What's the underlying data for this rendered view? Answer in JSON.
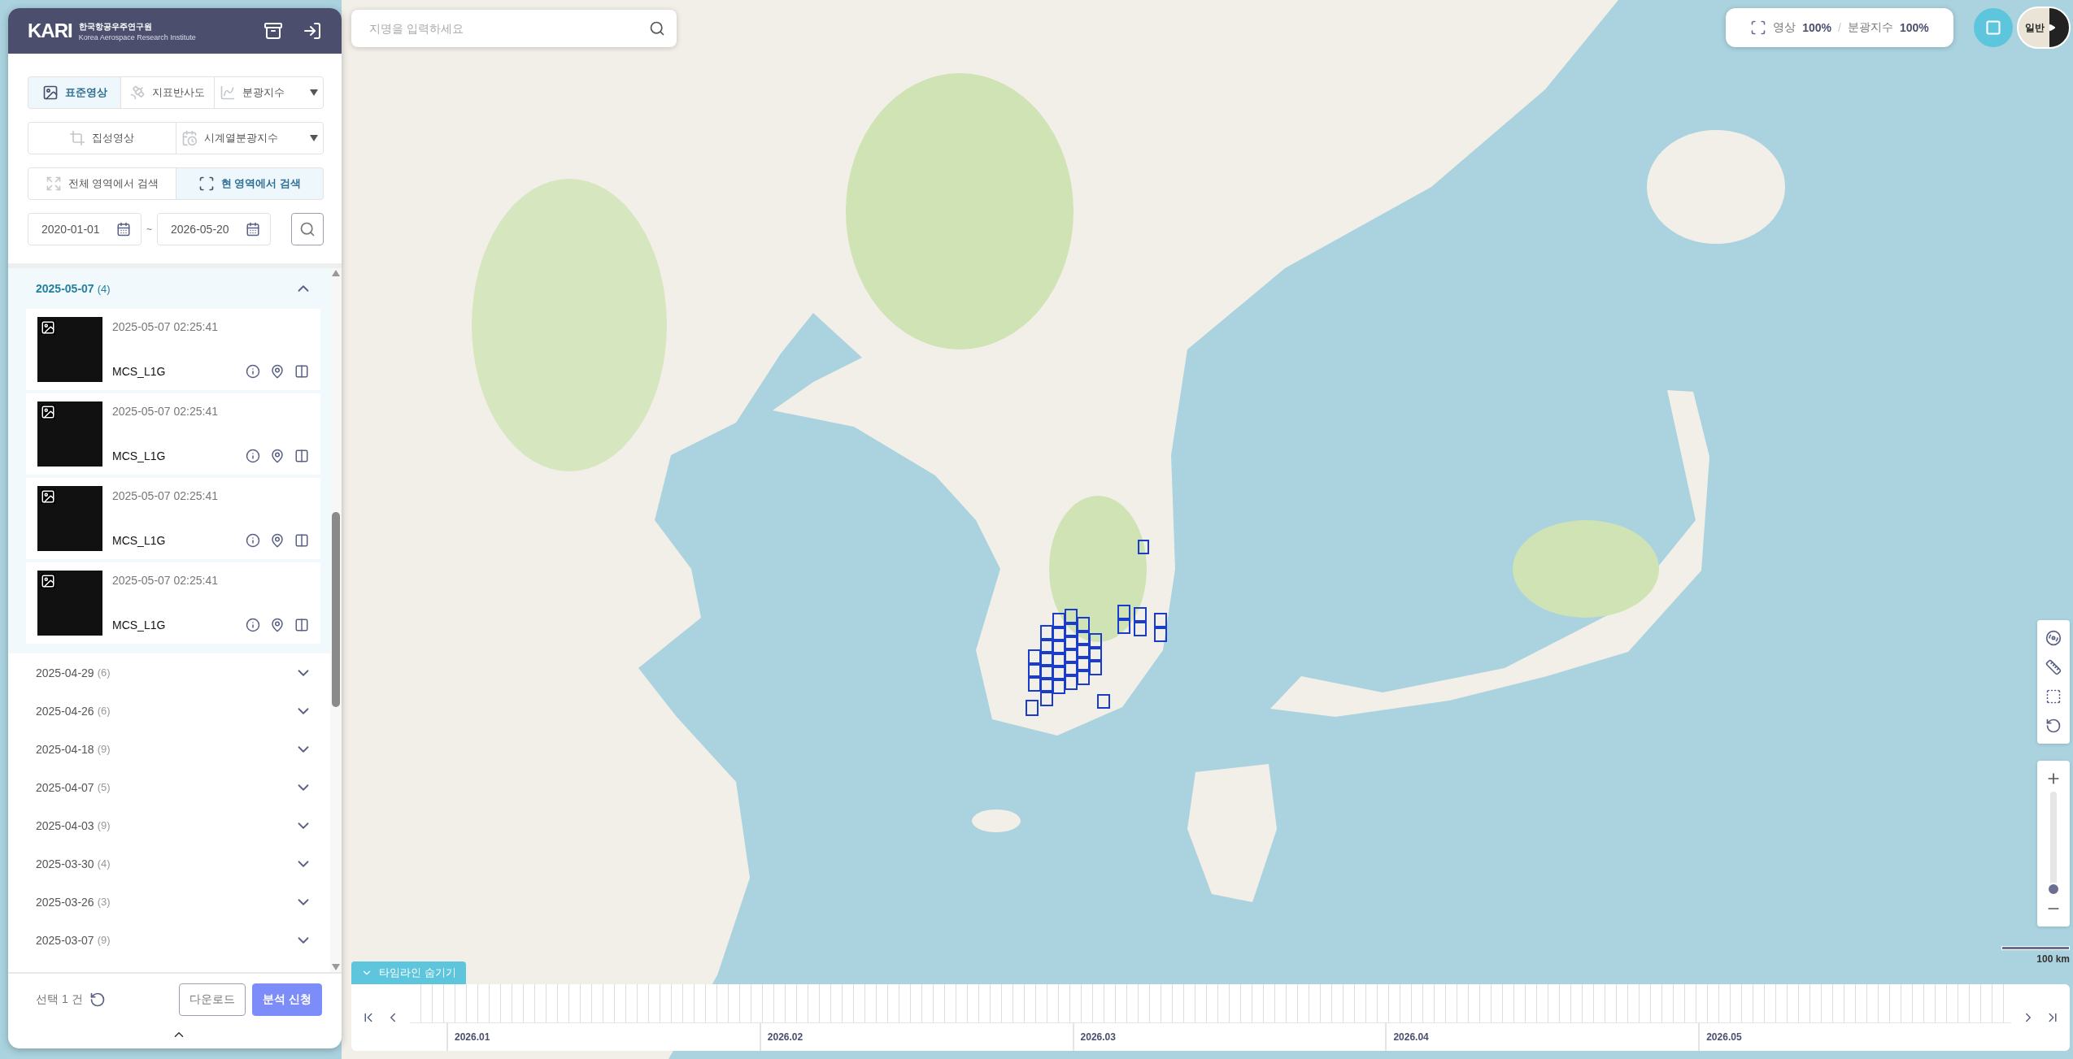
{
  "header": {
    "logo": "KARI",
    "org_name": "한국항공우주연구원",
    "org_name_en": "Korea Aerospace Research Institute"
  },
  "image_types": [
    {
      "label": "표준영상",
      "selected": true,
      "dropdown": false
    },
    {
      "label": "지표반사도",
      "selected": false,
      "dropdown": false
    },
    {
      "label": "분광지수",
      "selected": false,
      "dropdown": true
    }
  ],
  "products": [
    {
      "label": "집성영상",
      "selected": false,
      "dropdown": false
    },
    {
      "label": "시계열분광지수",
      "selected": false,
      "dropdown": true
    }
  ],
  "search_scope": [
    {
      "label": "전체 영역에서 검색",
      "selected": false
    },
    {
      "label": "현 영역에서 검색",
      "selected": true
    }
  ],
  "date_range": {
    "start": "2020-01-01",
    "separator": "~",
    "end": "2026-05-20"
  },
  "groups": [
    {
      "date": "2025-05-07",
      "count": "(4)",
      "expanded": true,
      "items": [
        {
          "time": "2025-05-07 02:25:41",
          "product": "MCS_L1G"
        },
        {
          "time": "2025-05-07 02:25:41",
          "product": "MCS_L1G"
        },
        {
          "time": "2025-05-07 02:25:41",
          "product": "MCS_L1G"
        },
        {
          "time": "2025-05-07 02:25:41",
          "product": "MCS_L1G"
        }
      ]
    },
    {
      "date": "2025-04-29",
      "count": "(6)",
      "expanded": false
    },
    {
      "date": "2025-04-26",
      "count": "(6)",
      "expanded": false
    },
    {
      "date": "2025-04-18",
      "count": "(9)",
      "expanded": false
    },
    {
      "date": "2025-04-07",
      "count": "(5)",
      "expanded": false
    },
    {
      "date": "2025-04-03",
      "count": "(9)",
      "expanded": false
    },
    {
      "date": "2025-03-30",
      "count": "(4)",
      "expanded": false
    },
    {
      "date": "2025-03-26",
      "count": "(3)",
      "expanded": false
    },
    {
      "date": "2025-03-07",
      "count": "(9)",
      "expanded": false
    }
  ],
  "footer": {
    "selection": "선택 1 건",
    "buttons": [
      {
        "label": "다운로드",
        "kind": "outline"
      },
      {
        "label": "분석 신청",
        "kind": "primary"
      }
    ]
  },
  "map": {
    "search_placeholder": "지명을 입력하세요",
    "opacity": {
      "image_label": "영상",
      "image_value": "100%",
      "separator": "/",
      "index_label": "분광지수",
      "index_value": "100%"
    },
    "basemap_label": "일반",
    "scale": "100 km",
    "zoom": {
      "level": 0.06
    }
  },
  "timeline": {
    "toggle": "타임라인 숨기기",
    "months": [
      "2026.01",
      "2026.02",
      "2026.03",
      "2026.04",
      "2026.05"
    ]
  }
}
